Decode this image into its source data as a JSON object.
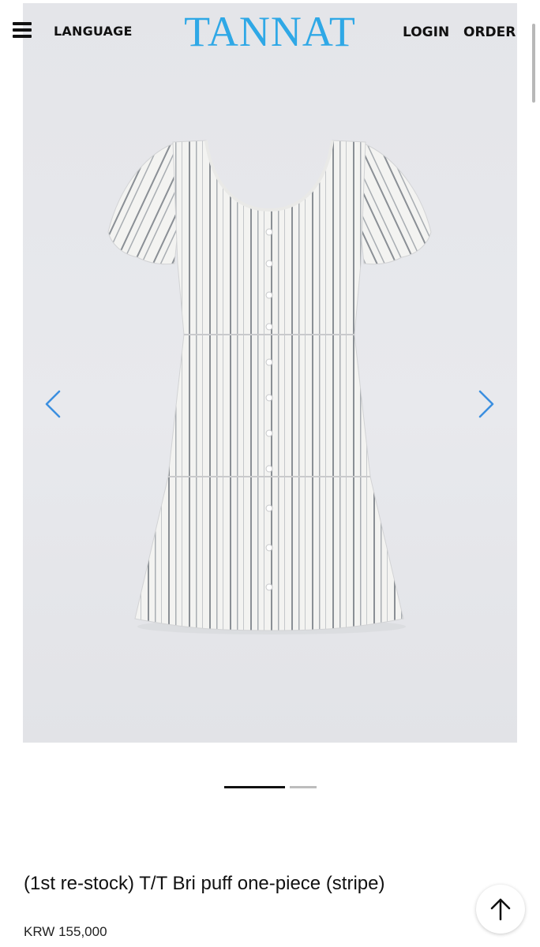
{
  "header": {
    "menu_icon": "hamburger-icon",
    "language_label": "LANGUAGE",
    "logo_text": "TANNAT",
    "logo_color": "#2fa8e6",
    "login_label": "LOGIN",
    "order_label": "ORDER"
  },
  "gallery": {
    "prev_icon": "chevron-left-icon",
    "next_icon": "chevron-right-icon",
    "arrow_color": "#3b8fe0",
    "current_slide": 1,
    "total_slides": 2
  },
  "product": {
    "name": "(1st re-stock) T/T Bri puff one-piece (stripe)",
    "price": "KRW 155,000"
  },
  "scroll_top": {
    "icon": "arrow-up-icon"
  }
}
